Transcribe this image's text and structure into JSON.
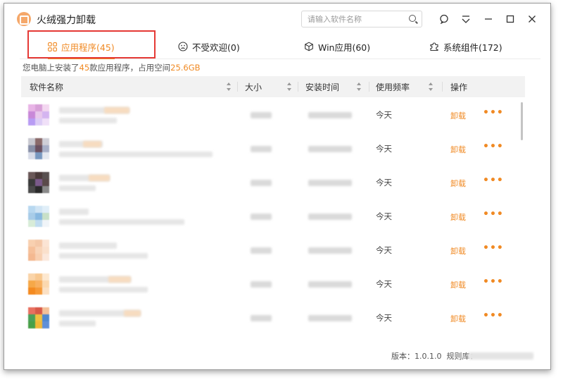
{
  "app": {
    "title": "火绒强力卸载"
  },
  "search": {
    "placeholder": "请输入软件名称"
  },
  "tabs": [
    {
      "label": "应用程序(45)",
      "icon": "grid-icon"
    },
    {
      "label": "不受欢迎(0)",
      "icon": "sad-face-icon"
    },
    {
      "label": "Win应用(60)",
      "icon": "box-icon"
    },
    {
      "label": "系统组件(172)",
      "icon": "puzzle-icon"
    }
  ],
  "summary": {
    "prefix": "您电脑上安装了",
    "count": "45",
    "middle": "款应用程序，占用空间",
    "size": "25.6GB"
  },
  "table": {
    "columns": [
      "软件名称",
      "大小",
      "安装时间",
      "使用频率",
      "操作"
    ],
    "rows": [
      {
        "usage": "今天",
        "action": "卸载"
      },
      {
        "usage": "今天",
        "action": "卸载"
      },
      {
        "usage": "今天",
        "action": "卸载"
      },
      {
        "usage": "今天",
        "action": "卸载"
      },
      {
        "usage": "今天",
        "action": "卸载"
      },
      {
        "usage": "今天",
        "action": "卸载"
      },
      {
        "usage": "今天",
        "action": "卸载"
      }
    ]
  },
  "footer": {
    "version": "版本：1.0.1.0",
    "rules_label": "规则库："
  },
  "colors": {
    "accent": "#f08a24",
    "highlight_box": "#e53935"
  }
}
